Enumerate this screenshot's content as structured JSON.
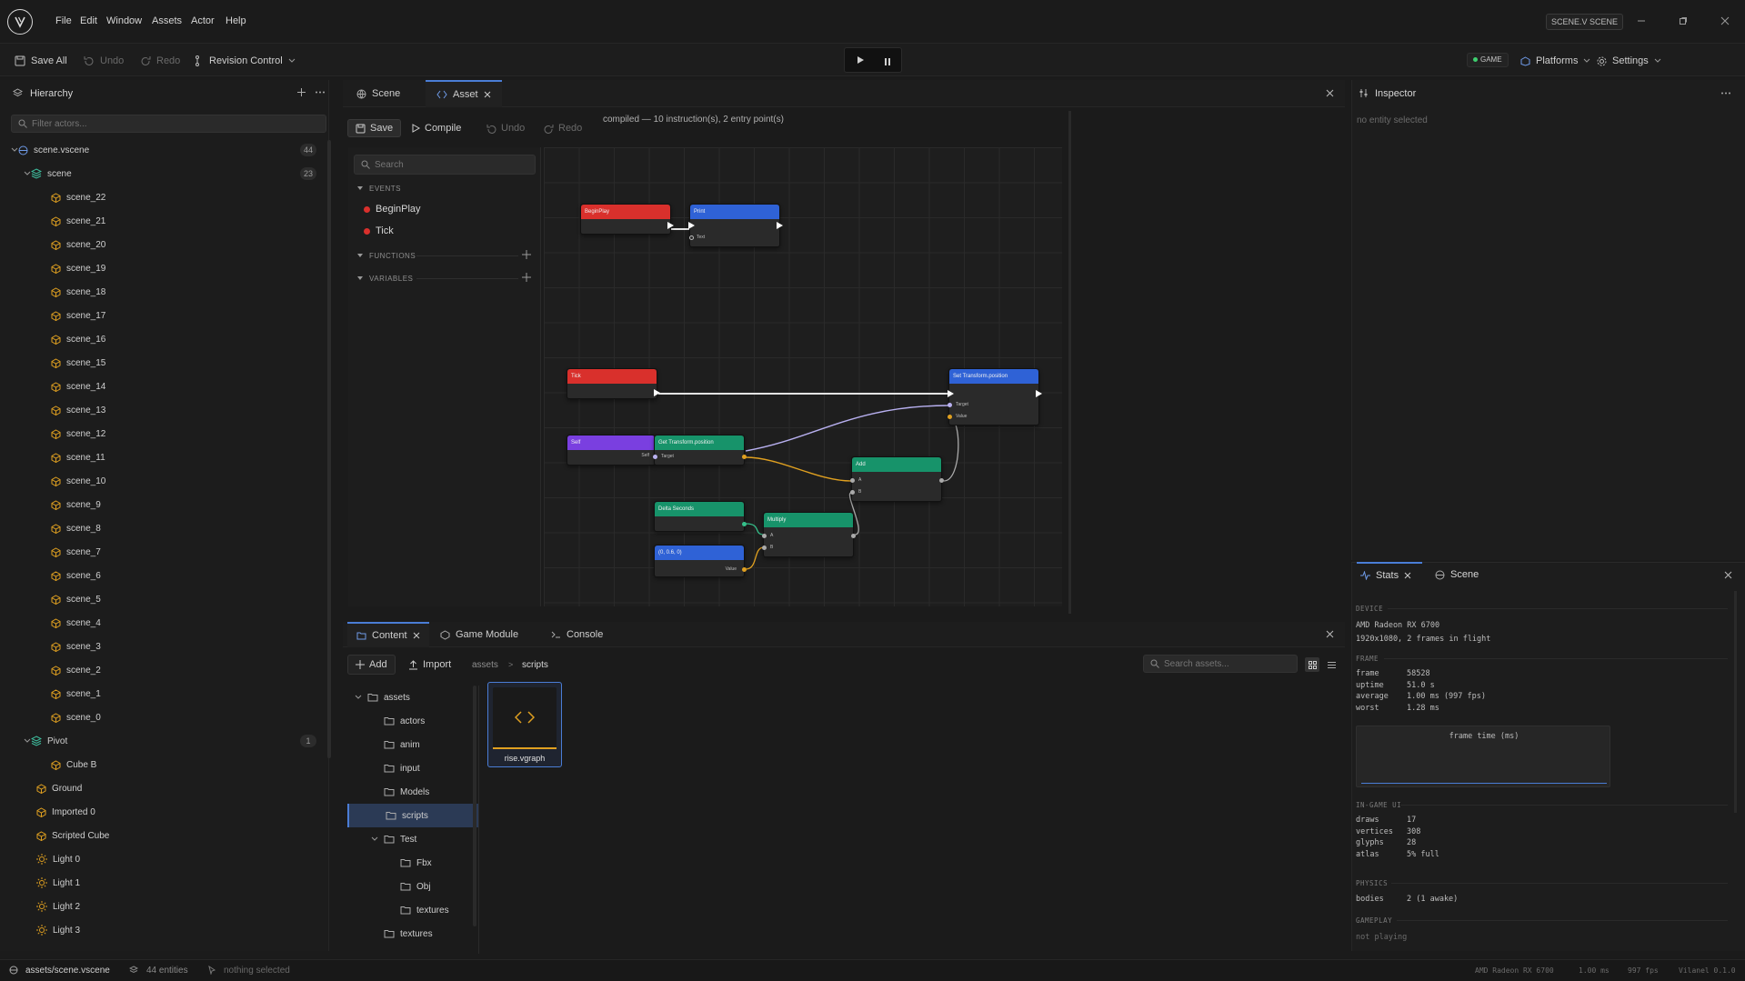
{
  "menubar": {
    "items": [
      "File",
      "Edit",
      "Window",
      "Assets",
      "Actor",
      "Help"
    ],
    "scene_chip": "SCENE.V SCENE"
  },
  "toolbar": {
    "save_all": "Save All",
    "undo": "Undo",
    "redo": "Redo",
    "revision_control": "Revision Control",
    "game_badge": "GAME",
    "platforms": "Platforms",
    "settings": "Settings"
  },
  "hierarchy": {
    "title": "Hierarchy",
    "filter_placeholder": "Filter actors...",
    "root": {
      "label": "scene.vscene",
      "count": "44"
    },
    "scene_group": {
      "label": "scene",
      "count": "23"
    },
    "scene_items": [
      "scene_22",
      "scene_21",
      "scene_20",
      "scene_19",
      "scene_18",
      "scene_17",
      "scene_16",
      "scene_15",
      "scene_14",
      "scene_13",
      "scene_12",
      "scene_11",
      "scene_10",
      "scene_9",
      "scene_8",
      "scene_7",
      "scene_6",
      "scene_5",
      "scene_4",
      "scene_3",
      "scene_2",
      "scene_1",
      "scene_0"
    ],
    "pivot": {
      "label": "Pivot",
      "count": "1",
      "child": "Cube B"
    },
    "others": [
      {
        "label": "Ground",
        "icon": "cube-icon"
      },
      {
        "label": "Imported 0",
        "icon": "cube-icon"
      },
      {
        "label": "Scripted Cube",
        "icon": "cube-icon"
      },
      {
        "label": "Light 0",
        "icon": "light-icon"
      },
      {
        "label": "Light 1",
        "icon": "light-icon"
      },
      {
        "label": "Light 2",
        "icon": "light-icon"
      },
      {
        "label": "Light 3",
        "icon": "light-icon"
      }
    ]
  },
  "center": {
    "tabs": [
      {
        "label": "Scene"
      },
      {
        "label": "Asset"
      }
    ],
    "graph_toolbar": {
      "save": "Save",
      "compile": "Compile",
      "undo": "Undo",
      "redo": "Redo",
      "status": "compiled — 10 instruction(s), 2 entry point(s)"
    },
    "sidebar": {
      "search_placeholder": "Search",
      "events_label": "EVENTS",
      "events": [
        "BeginPlay",
        "Tick"
      ],
      "functions_label": "FUNCTIONS",
      "variables_label": "VARIABLES"
    },
    "nodes": {
      "begin_play": "BeginPlay",
      "print": "Print",
      "print_pin": "Text",
      "tick": "Tick",
      "set_transform": "Set Transform.position",
      "set_target": "Target",
      "set_value": "Value",
      "self": "Self",
      "self_pin": "Self",
      "get_transform": "Get Transform.position",
      "get_target": "Target",
      "add": "Add",
      "add_a": "A",
      "add_b": "B",
      "delta": "Delta Seconds",
      "multiply": "Multiply",
      "mul_a": "A",
      "mul_b": "B",
      "vec": "(0, 0.6, 0)",
      "vec_value": "Value"
    }
  },
  "bottom": {
    "tabs": [
      {
        "label": "Content"
      },
      {
        "label": "Game Module"
      },
      {
        "label": "Console"
      }
    ],
    "add": "Add",
    "import": "Import",
    "breadcrumb": [
      "assets",
      "scripts"
    ],
    "search_placeholder": "Search assets...",
    "tree": [
      {
        "label": "assets",
        "depth": 0,
        "open": true
      },
      {
        "label": "actors",
        "depth": 1
      },
      {
        "label": "anim",
        "depth": 1
      },
      {
        "label": "input",
        "depth": 1
      },
      {
        "label": "Models",
        "depth": 1
      },
      {
        "label": "scripts",
        "depth": 1,
        "selected": true
      },
      {
        "label": "Test",
        "depth": 1,
        "open": true
      },
      {
        "label": "Fbx",
        "depth": 2
      },
      {
        "label": "Obj",
        "depth": 2
      },
      {
        "label": "textures",
        "depth": 2
      },
      {
        "label": "textures",
        "depth": 1
      }
    ],
    "tile_label": "rise.vgraph"
  },
  "inspector": {
    "title": "Inspector",
    "empty": "no entity selected"
  },
  "stats": {
    "tabs": [
      {
        "label": "Stats"
      },
      {
        "label": "Scene"
      }
    ],
    "device_label": "DEVICE",
    "device": "AMD Radeon RX 6700",
    "resolution": "1920x1080, 2 frames in flight",
    "frame_label": "FRAME",
    "frame_rows": [
      {
        "k": "frame",
        "v": "58528"
      },
      {
        "k": "uptime",
        "v": "51.0 s"
      },
      {
        "k": "average",
        "v": "1.00 ms  (997 fps)"
      },
      {
        "k": "worst",
        "v": "1.28 ms"
      }
    ],
    "graph_title": "frame time (ms)",
    "ui_label": "IN-GAME UI",
    "ui_rows": [
      {
        "k": "draws",
        "v": "17"
      },
      {
        "k": "vertices",
        "v": "308"
      },
      {
        "k": "glyphs",
        "v": "28"
      },
      {
        "k": "atlas",
        "v": "5% full"
      }
    ],
    "physics_label": "PHYSICS",
    "physics_rows": [
      {
        "k": "bodies",
        "v": "2  (1 awake)"
      }
    ],
    "gameplay_label": "GAMEPLAY",
    "gameplay": "not playing"
  },
  "statusbar": {
    "path": "assets/scene.vscene",
    "entities": "44 entities",
    "selection": "nothing selected",
    "gpu": "AMD Radeon RX 6700",
    "ms": "1.00 ms",
    "fps": "997 fps",
    "version": "Vilanel 0.1.0"
  },
  "colors": {
    "accent": "#4a7dd6",
    "event": "#d9302c",
    "function": "#2f62d6",
    "pure": "#17936a",
    "self": "#7a3fe0",
    "game_dot": "#3ecf6f"
  }
}
